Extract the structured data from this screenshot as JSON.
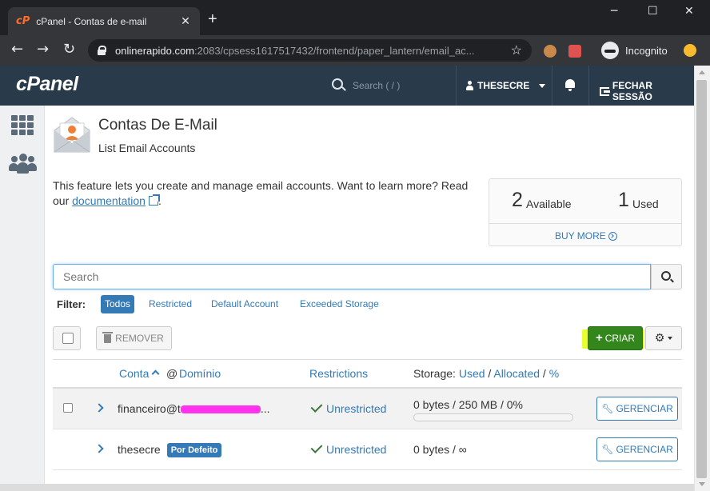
{
  "browser": {
    "tab_title": "cPanel - Contas de e-mail",
    "tab_favicon": "cP",
    "url_host": "onlinerapido.com",
    "url_rest": ":2083/cpsess1617517432/frontend/paper_lantern/email_ac...",
    "incognito_label": "Incognito"
  },
  "header": {
    "logo": "cPanel",
    "search_placeholder": "Search ( / )",
    "username": "THESECRE",
    "logout_label": "FECHAR SESSÃO"
  },
  "page": {
    "title": "Contas De E-Mail",
    "subtitle": "List Email Accounts",
    "intro_text": "This feature lets you create and manage email accounts. Want to learn more? Read our",
    "doc_link": "documentation",
    "intro_end": "."
  },
  "stats": {
    "available_count": "2",
    "available_label": "Available",
    "used_count": "1",
    "used_label": "Used",
    "buy_more": "BUY MORE"
  },
  "search": {
    "placeholder": "Search"
  },
  "filter": {
    "label": "Filter:",
    "options": [
      "Todos",
      "Restricted",
      "Default Account",
      "Exceeded Storage"
    ],
    "active": "Todos"
  },
  "toolbar": {
    "remove_label": "REMOVER",
    "create_label": "CRIAR"
  },
  "table": {
    "headers": {
      "account": "Conta",
      "at": "@",
      "domain": "Domínio",
      "restrictions": "Restrictions",
      "storage_prefix": "Storage:",
      "used": "Used",
      "sep1": "/",
      "allocated": "Allocated",
      "sep2": "/",
      "percent": "%"
    },
    "rows": [
      {
        "account": "financeiro@t",
        "account_suffix": "...",
        "restriction": "Unrestricted",
        "storage": "0 bytes / 250 MB / 0%",
        "usage_fraction": 0,
        "manage_label": "GERENCIAR"
      },
      {
        "account": "thesecre",
        "badge": "Por Defeito",
        "restriction": "Unrestricted",
        "storage": "0 bytes / ∞",
        "manage_label": "GERENCIAR"
      }
    ]
  },
  "colors": {
    "header_bg": "#293a4a",
    "accent": "#337ab7",
    "create_btn": "#33861b",
    "highlight": "#e7ff2e",
    "redaction": "#ff33ee",
    "success": "#3c763d"
  }
}
